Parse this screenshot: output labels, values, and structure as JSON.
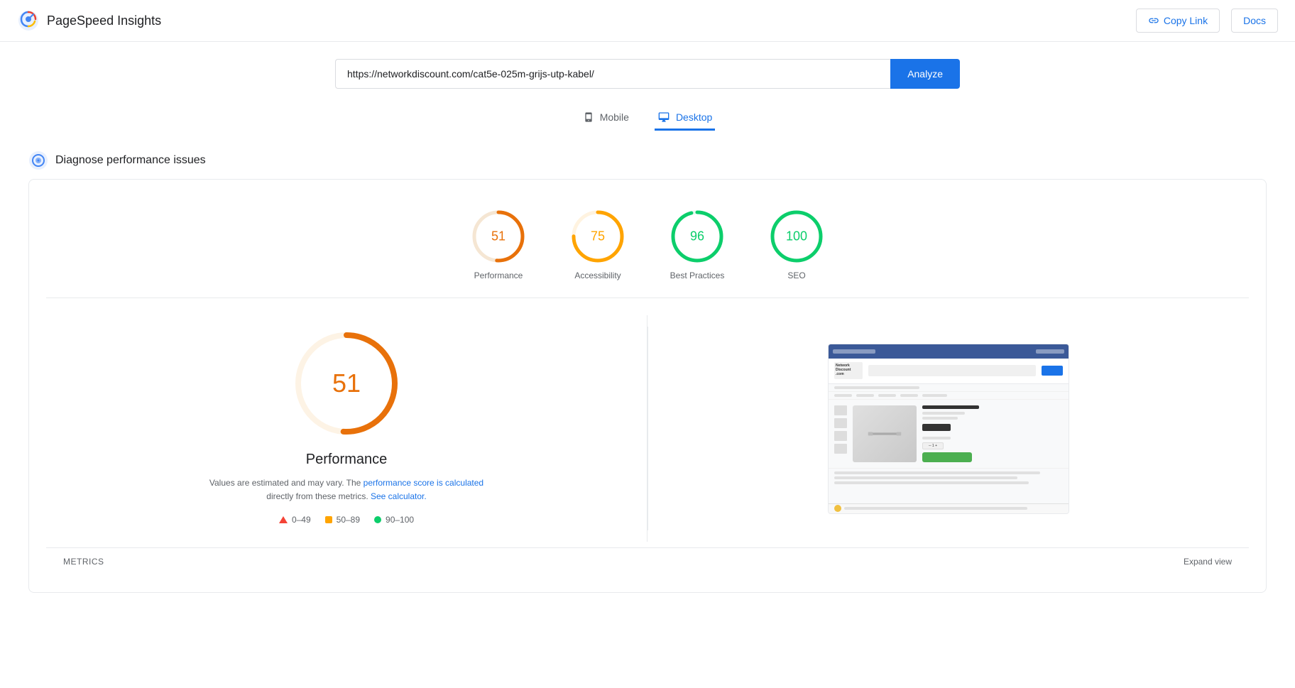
{
  "header": {
    "title": "PageSpeed Insights",
    "copy_link_label": "Copy Link",
    "docs_label": "Docs"
  },
  "url_bar": {
    "url_value": "https://networkdiscount.com/cat5e-025m-grijs-utp-kabel/",
    "analyze_label": "Analyze"
  },
  "tabs": [
    {
      "id": "mobile",
      "label": "Mobile",
      "active": false
    },
    {
      "id": "desktop",
      "label": "Desktop",
      "active": true
    }
  ],
  "diagnose": {
    "title": "Diagnose performance issues"
  },
  "scores": [
    {
      "id": "performance",
      "value": 51,
      "label": "Performance",
      "color": "#e8710a",
      "track_color": "#f5e6d3",
      "dash": 163,
      "offset": 80
    },
    {
      "id": "accessibility",
      "value": 75,
      "label": "Accessibility",
      "color": "#ffa400",
      "track_color": "#fff3e0",
      "dash": 163,
      "offset": 41
    },
    {
      "id": "best-practices",
      "value": 96,
      "label": "Best Practices",
      "color": "#0cce6b",
      "track_color": "#e6f9f0",
      "dash": 163,
      "offset": 6.5
    },
    {
      "id": "seo",
      "value": 100,
      "label": "SEO",
      "color": "#0cce6b",
      "track_color": "#e6f9f0",
      "dash": 163,
      "offset": 0
    }
  ],
  "performance_panel": {
    "big_score": 51,
    "title": "Performance",
    "note_text": "Values are estimated and may vary. The ",
    "note_link1": "performance score is calculated",
    "note_link1_text": "performance score is calculated",
    "note_middle": " directly from these metrics. ",
    "note_link2": "See calculator.",
    "legend": [
      {
        "id": "fail",
        "range": "0–49",
        "shape": "triangle",
        "color": "#f44336"
      },
      {
        "id": "average",
        "range": "50–89",
        "shape": "square",
        "color": "#ffa400"
      },
      {
        "id": "pass",
        "range": "90–100",
        "shape": "circle",
        "color": "#0cce6b"
      }
    ]
  },
  "metrics_footer": {
    "label": "METRICS",
    "expand_label": "Expand view"
  }
}
